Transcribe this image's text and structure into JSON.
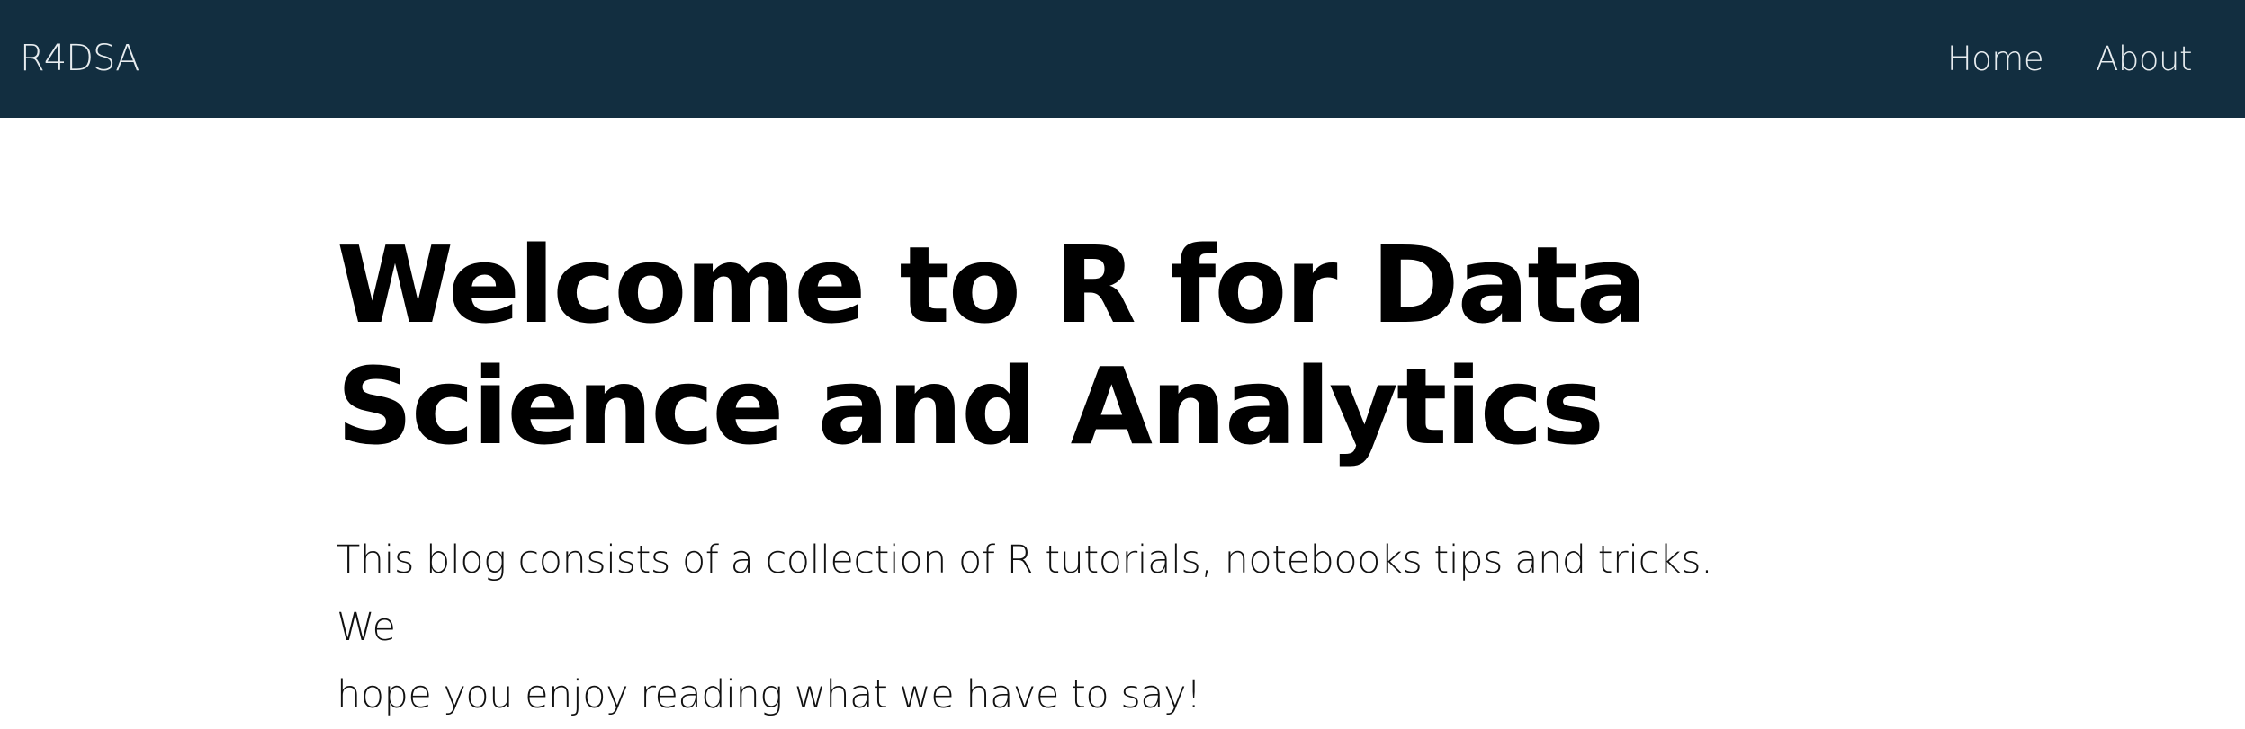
{
  "navbar": {
    "brand": "R4DSA",
    "links": [
      {
        "label": "Home"
      },
      {
        "label": "About"
      }
    ]
  },
  "main": {
    "title_line1": "Welcome to R for Data",
    "title_line2": "Science and Analytics",
    "intro_line1": "This blog consists of a collection of R tutorials, notebooks tips and tricks. We",
    "intro_line2": "hope you enjoy reading what we have to say!"
  },
  "colors": {
    "navbar_bg": "#122e40",
    "navbar_text": "#e7ecef",
    "page_bg": "#ffffff",
    "text": "#000000"
  }
}
